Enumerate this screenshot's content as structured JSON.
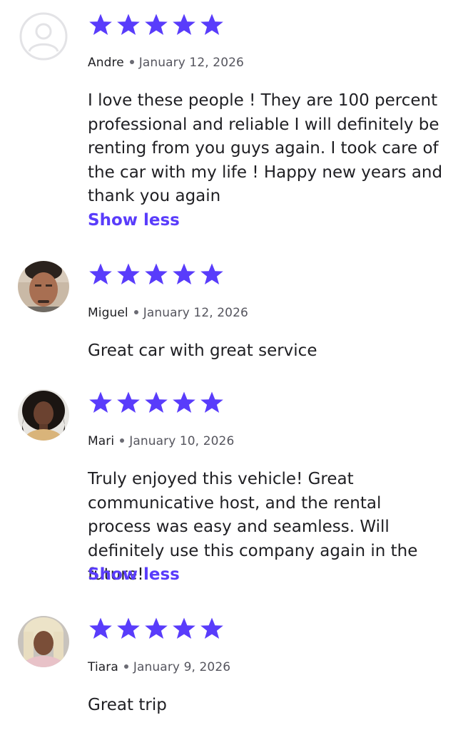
{
  "colors": {
    "star": "#593cfb",
    "link": "#593cfb",
    "text": "#1f1f23",
    "muted": "#55555e"
  },
  "reviews": [
    {
      "author": "Andre",
      "date": "January 12, 2026",
      "rating": 5,
      "avatar": "default-user-icon",
      "text": "I love these people ! They are 100 percent professional and reliable I will definitely be renting from you guys again. I took care of the car with my life ! Happy new years and thank you again",
      "toggle_label": "Show less"
    },
    {
      "author": "Miguel",
      "date": "January 12, 2026",
      "rating": 5,
      "avatar": "user-photo",
      "text": "Great car with great service"
    },
    {
      "author": "Mari",
      "date": "January 10, 2026",
      "rating": 5,
      "avatar": "user-photo",
      "text": "Truly enjoyed this vehicle! Great communicative host, and the rental process was easy and seamless. Will definitely use this company again in the future!",
      "toggle_label": "Show less"
    },
    {
      "author": "Tiara",
      "date": "January 9, 2026",
      "rating": 5,
      "avatar": "user-photo",
      "text": "Great trip"
    }
  ]
}
